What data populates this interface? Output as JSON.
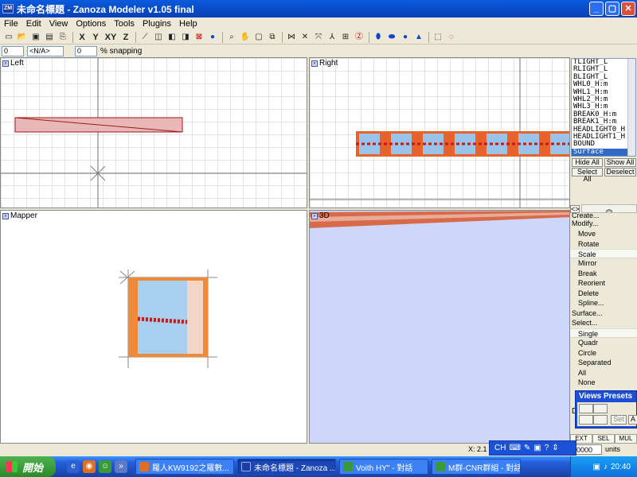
{
  "window": {
    "title": "未命名標題 - Zanoza Modeler v1.05 final",
    "app_icon_text": "ZM"
  },
  "menu": [
    "File",
    "Edit",
    "View",
    "Options",
    "Tools",
    "Plugins",
    "Help"
  ],
  "toolbar": {
    "axis_x": "X",
    "axis_y": "Y",
    "axis_xy": "XY",
    "axis_z": "Z"
  },
  "statusstrip": {
    "spin1_value": "0",
    "combo_value": "<N/A>",
    "spin2_value": "0",
    "snapping_label": "% snapping"
  },
  "viewports": {
    "left": "Left",
    "right": "Right",
    "mapper": "Mapper",
    "3d": "3D"
  },
  "object_list": [
    "TLIGHT_L",
    "RLIGHT_L",
    "BLIGHT_L",
    "WHL0_H:m",
    "WHL1_H:m",
    "WHL2_H:m",
    "WHL3_H:m",
    "BREAK0_H:m",
    "BREAK1_H:m",
    "HEADLIGHT0_H",
    "HEADLIGHT1_H",
    "BOUND",
    "Surface"
  ],
  "object_list_selected": "Surface",
  "list_buttons": {
    "hide_all": "Hide All",
    "show_all": "Show All",
    "select_all": "Select All",
    "deselect": "Deselect"
  },
  "panel_toggle": "<>",
  "create_label": "Create...",
  "modify": {
    "heading": "Modify...",
    "items": [
      "Move",
      "Rotate",
      "Scale",
      "Mirror",
      "Break",
      "Reorient",
      "Delete",
      "Spline..."
    ]
  },
  "surface_label": "Surface...",
  "select": {
    "heading": "Select...",
    "items": [
      "Single",
      "Quadr",
      "Circle",
      "Separated",
      "All",
      "None"
    ]
  },
  "views_presets": {
    "title": "Views Presets",
    "set_label": "Set",
    "a_label": "A",
    "d_label": "D"
  },
  "modes": [
    "EXT",
    "SEL",
    "MUL"
  ],
  "status": {
    "coord_label": "X: 2.1",
    "units_value": "00000",
    "units_label": "units"
  },
  "language_bar": {
    "lang": "CH"
  },
  "taskbar": {
    "start": "開始",
    "tasks": [
      "羅人KW9192之羅數...",
      "未命名標題 - Zanoza ...",
      "Voith HY\" - 對話",
      "M群-CNR群組 - 對話"
    ],
    "active_task_index": 1,
    "clock": "20:40"
  },
  "colors": {
    "titlebar": "#0a3fb6",
    "selection": "#316ac5",
    "taskbar": "#245edb",
    "start": "#2a8a2a",
    "mesh_fill": "#e8b8b8",
    "mesh_stroke": "#a01818",
    "viewport_3d_bg": "#cfd6fb"
  }
}
